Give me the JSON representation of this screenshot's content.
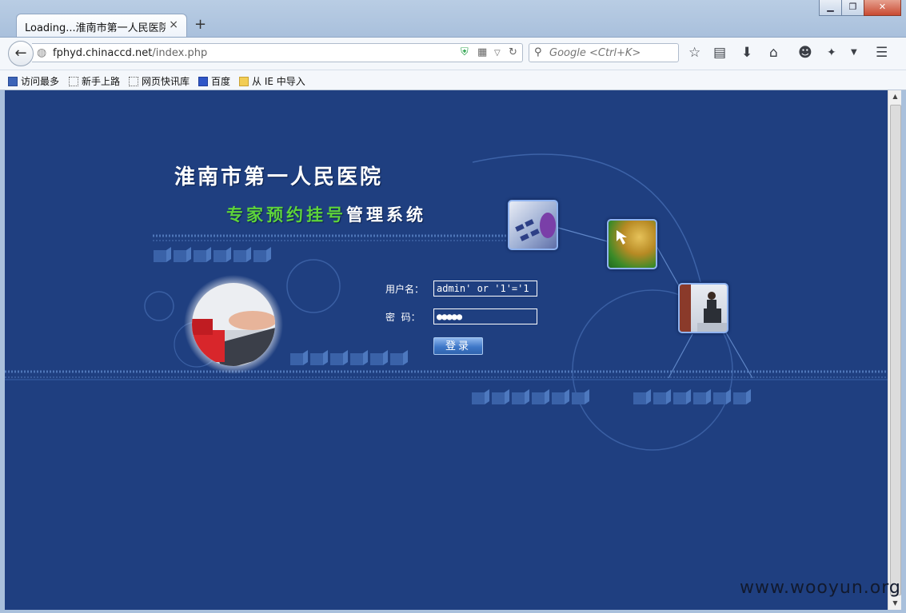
{
  "browser": {
    "tab_title": "Loading...淮南市第一人民医院...",
    "tab_close": "×",
    "new_tab": "+",
    "url_host": "fphyd.chinaccd.net",
    "url_path": "/index.php",
    "search_placeholder": "Google <Ctrl+K>",
    "window_buttons": [
      "minimize",
      "maximize",
      "close"
    ]
  },
  "bookmarks": [
    {
      "label": "访问最多",
      "icon": "most-visited-icon"
    },
    {
      "label": "新手上路",
      "icon": "page-icon"
    },
    {
      "label": "网页快讯库",
      "icon": "page-icon"
    },
    {
      "label": "百度",
      "icon": "baidu-paw-icon"
    },
    {
      "label": "从 IE 中导入",
      "icon": "folder-icon"
    }
  ],
  "page": {
    "title": "淮南市第一人民医院",
    "subtitle_green": "专家预约挂号",
    "subtitle_white": "管理系统",
    "login": {
      "username_label": "用户名：",
      "username_value": "admin' or '1'='1",
      "password_label": "密  码：",
      "password_mask": "●●●●●",
      "submit_label": "登录"
    },
    "colors": {
      "background": "#1f3f80",
      "accent_green": "#5ed43a"
    }
  },
  "watermark": "www.wooyun.org"
}
